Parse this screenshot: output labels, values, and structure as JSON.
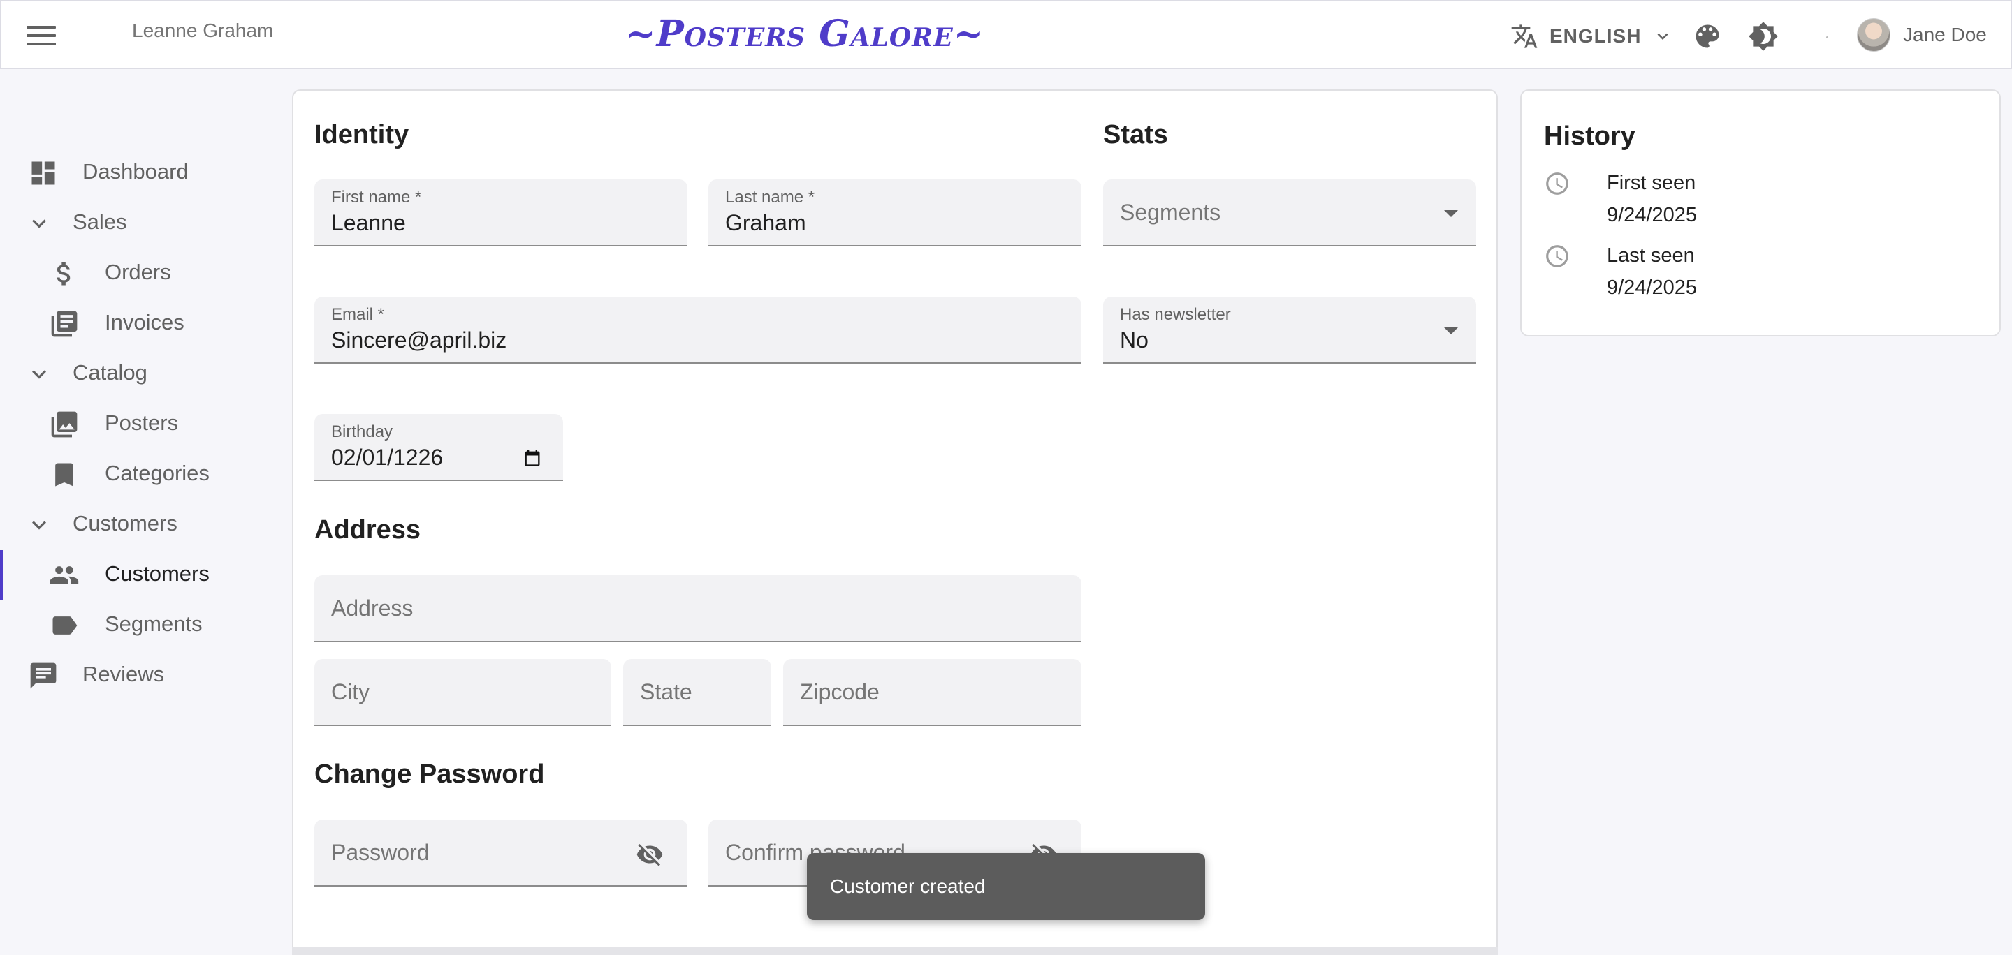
{
  "appbar": {
    "title": "Leanne Graham",
    "brand": "~Posters Galore~",
    "language": "ENGLISH",
    "user_name": "Jane Doe"
  },
  "sidebar": {
    "items": [
      {
        "label": "Dashboard",
        "icon": "dashboard-icon"
      },
      {
        "label": "Sales",
        "icon": "chevron-down-icon"
      },
      {
        "label": "Orders",
        "icon": "dollar-icon"
      },
      {
        "label": "Invoices",
        "icon": "invoices-icon"
      },
      {
        "label": "Catalog",
        "icon": "chevron-down-icon"
      },
      {
        "label": "Posters",
        "icon": "image-icon"
      },
      {
        "label": "Categories",
        "icon": "bookmark-icon"
      },
      {
        "label": "Customers",
        "icon": "chevron-down-icon"
      },
      {
        "label": "Customers",
        "icon": "people-icon",
        "active": true
      },
      {
        "label": "Segments",
        "icon": "label-icon"
      },
      {
        "label": "Reviews",
        "icon": "comment-icon"
      }
    ]
  },
  "form": {
    "identity_title": "Identity",
    "stats_title": "Stats",
    "address_title": "Address",
    "password_title": "Change Password",
    "first_name": {
      "label": "First name *",
      "value": "Leanne"
    },
    "last_name": {
      "label": "Last name *",
      "value": "Graham"
    },
    "email": {
      "label": "Email *",
      "value": "Sincere@april.biz"
    },
    "birthday": {
      "label": "Birthday",
      "value": "02/01/1226"
    },
    "segments": {
      "placeholder": "Segments"
    },
    "newsletter": {
      "label": "Has newsletter",
      "value": "No"
    },
    "address": {
      "placeholder": "Address"
    },
    "city": {
      "placeholder": "City"
    },
    "state": {
      "placeholder": "State"
    },
    "zipcode": {
      "placeholder": "Zipcode"
    },
    "password": {
      "placeholder": "Password"
    },
    "confirm_password": {
      "placeholder": "Confirm password"
    }
  },
  "history": {
    "title": "History",
    "first_seen_label": "First seen",
    "first_seen_value": "9/24/2025",
    "last_seen_label": "Last seen",
    "last_seen_value": "9/24/2025"
  },
  "snackbar": {
    "message": "Customer created"
  },
  "colors": {
    "accent": "#4f3cc9",
    "background": "#f6f6fa",
    "field_bg": "#f2f2f4",
    "snackbar_bg": "#5c5c5c"
  }
}
